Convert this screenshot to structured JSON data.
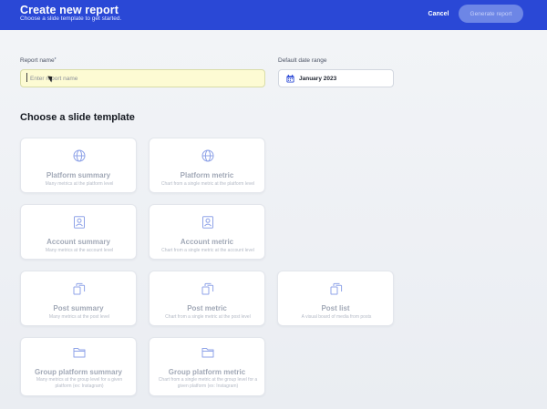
{
  "header": {
    "title": "Create new report",
    "subtitle": "Choose a slide template to get started.",
    "cancel_label": "Cancel",
    "generate_label": "Generate report",
    "background_color": "#2a48d6"
  },
  "form": {
    "report_name": {
      "label": "Report name",
      "required_mark": "*",
      "placeholder": "Enter report name",
      "value": ""
    },
    "date_range": {
      "label": "Default date range",
      "value": "January 2023",
      "icon": "calendar-icon"
    }
  },
  "templates": {
    "section_title": "Choose a slide template",
    "items": [
      {
        "title": "Platform summary",
        "description": "Many metrics at the platform level",
        "icon": "globe-icon"
      },
      {
        "title": "Platform metric",
        "description": "Chart from a single metric at the platform level",
        "icon": "globe-icon"
      },
      {
        "title": "Account summary",
        "description": "Many metrics at the account level",
        "icon": "account-icon"
      },
      {
        "title": "Account metric",
        "description": "Chart from a single metric at the account level",
        "icon": "account-icon"
      },
      {
        "title": "Post summary",
        "description": "Many metrics at the post level",
        "icon": "posts-icon"
      },
      {
        "title": "Post metric",
        "description": "Chart from a single metric at the post level",
        "icon": "posts-icon"
      },
      {
        "title": "Post list",
        "description": "A visual board of media from posts",
        "icon": "posts-icon"
      },
      {
        "title": "Group platform summary",
        "description": "Many metrics at the group level for a given platform (ex: Instagram)",
        "icon": "folder-icon"
      },
      {
        "title": "Group platform metric",
        "description": "Chart from a single metric at the group level for a given platform (ex: Instagram)",
        "icon": "folder-icon"
      }
    ]
  }
}
